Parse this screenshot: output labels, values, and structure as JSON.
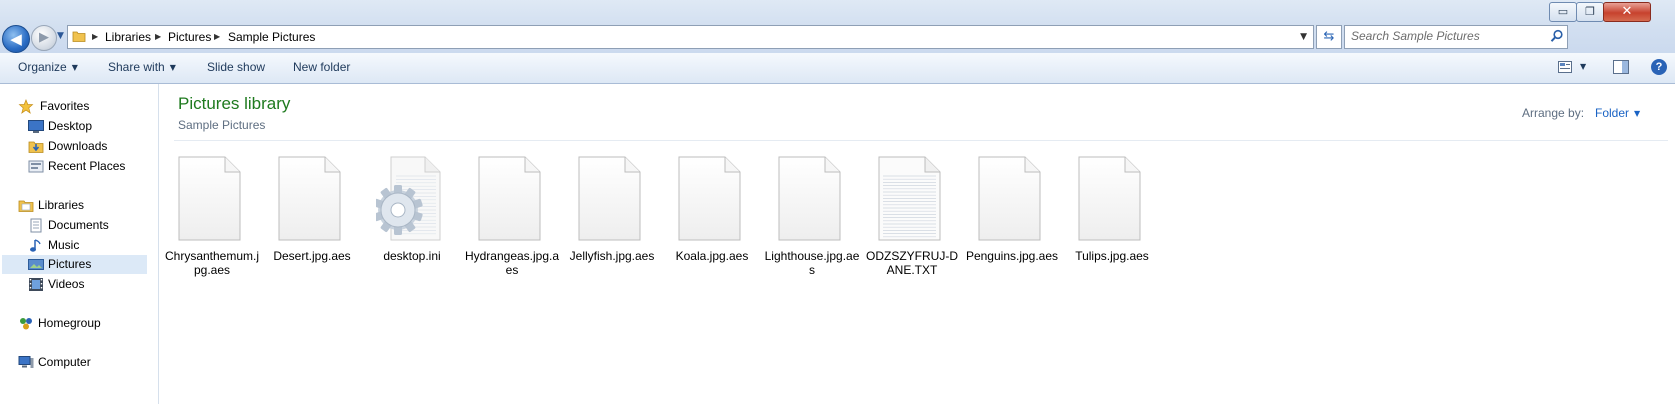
{
  "window": {
    "controls": {
      "minimize_glyph": "▭",
      "restore_glyph": "❐",
      "close_glyph": "✕"
    }
  },
  "nav_buttons": {
    "back_glyph": "◀",
    "forward_glyph": "▶",
    "recent_glyph": "▼"
  },
  "address": {
    "segments": [
      "Libraries",
      "Pictures",
      "Sample Pictures"
    ],
    "separator": "▶",
    "dropdown_glyph": "▼",
    "refresh_glyph": "⇆"
  },
  "search": {
    "placeholder": "Search Sample Pictures",
    "value": ""
  },
  "toolbar": {
    "organize": "Organize",
    "share_with": "Share with",
    "slide_show": "Slide show",
    "new_folder": "New folder",
    "dropdown_glyph": "▼",
    "help_glyph": "?"
  },
  "sidebar": {
    "favorites": {
      "label": "Favorites",
      "items": [
        {
          "label": "Desktop",
          "icon": "desktop-icon"
        },
        {
          "label": "Downloads",
          "icon": "downloads-icon"
        },
        {
          "label": "Recent Places",
          "icon": "recent-places-icon"
        }
      ]
    },
    "libraries": {
      "label": "Libraries",
      "items": [
        {
          "label": "Documents",
          "icon": "documents-icon"
        },
        {
          "label": "Music",
          "icon": "music-icon"
        },
        {
          "label": "Pictures",
          "icon": "pictures-icon",
          "selected": true
        },
        {
          "label": "Videos",
          "icon": "videos-icon"
        }
      ]
    },
    "homegroup": {
      "label": "Homegroup"
    },
    "computer": {
      "label": "Computer"
    }
  },
  "main": {
    "title": "Pictures library",
    "subtitle": "Sample Pictures",
    "arrange_label": "Arrange by:",
    "arrange_value": "Folder",
    "files": [
      {
        "name": "Chrysanthemum.jpg.aes",
        "icon": "generic-file-icon"
      },
      {
        "name": "Desert.jpg.aes",
        "icon": "generic-file-icon"
      },
      {
        "name": "desktop.ini",
        "icon": "settings-file-icon"
      },
      {
        "name": "Hydrangeas.jpg.aes",
        "icon": "generic-file-icon"
      },
      {
        "name": "Jellyfish.jpg.aes",
        "icon": "generic-file-icon"
      },
      {
        "name": "Koala.jpg.aes",
        "icon": "generic-file-icon"
      },
      {
        "name": "Lighthouse.jpg.aes",
        "icon": "generic-file-icon"
      },
      {
        "name": "ODZSZYFRUJ-DANE.TXT",
        "icon": "text-file-icon"
      },
      {
        "name": "Penguins.jpg.aes",
        "icon": "generic-file-icon"
      },
      {
        "name": "Tulips.jpg.aes",
        "icon": "generic-file-icon"
      }
    ]
  },
  "colors": {
    "library_title": "#1e7a1e",
    "link_blue": "#1a63c4",
    "chrome_top": "#dfe9f5",
    "selected_bg": "#dce9f7"
  }
}
